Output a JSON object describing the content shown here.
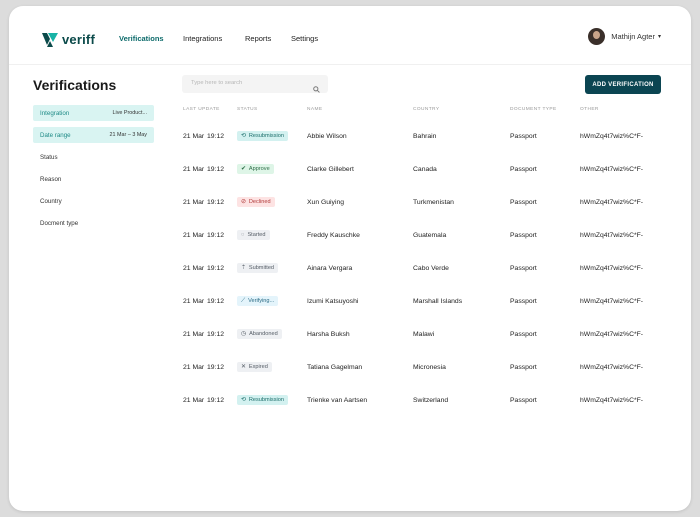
{
  "brand": {
    "name": "veriff"
  },
  "nav": [
    {
      "label": "Verifications",
      "active": true
    },
    {
      "label": "Integrations",
      "active": false
    },
    {
      "label": "Reports",
      "active": false
    },
    {
      "label": "Settings",
      "active": false
    }
  ],
  "user": {
    "name": "Mathijn Agter"
  },
  "page": {
    "title": "Verifications"
  },
  "search": {
    "placeholder": "Type here to search"
  },
  "add_button": {
    "label": "ADD VERIFICATION"
  },
  "filters": [
    {
      "label": "Integration",
      "value": "Live Product...",
      "active": true
    },
    {
      "label": "Date range",
      "value": "21 Mar – 3 May",
      "active": true
    },
    {
      "label": "Status",
      "value": "",
      "active": false
    },
    {
      "label": "Reason",
      "value": "",
      "active": false
    },
    {
      "label": "Country",
      "value": "",
      "active": false
    },
    {
      "label": "Docment type",
      "value": "",
      "active": false
    }
  ],
  "table": {
    "columns": [
      "Last update",
      "Status",
      "Name",
      "Country",
      "Document type",
      "Other"
    ],
    "rows": [
      {
        "date": "21 Mar",
        "time": "19:12",
        "status": "Resubmission",
        "status_kind": "resubmission",
        "name": "Abbie Wilson",
        "country": "Bahrain",
        "doc": "Passport",
        "other": "hWmZq4t7wiz%C*F-"
      },
      {
        "date": "21 Mar",
        "time": "19:12",
        "status": "Approve",
        "status_kind": "approved",
        "name": "Clarke Gillebert",
        "country": "Canada",
        "doc": "Passport",
        "other": "hWmZq4t7wiz%C*F-"
      },
      {
        "date": "21 Mar",
        "time": "19:12",
        "status": "Declined",
        "status_kind": "declined",
        "name": "Xun Guiying",
        "country": "Turkmenistan",
        "doc": "Passport",
        "other": "hWmZq4t7wiz%C*F-"
      },
      {
        "date": "21 Mar",
        "time": "19:12",
        "status": "Started",
        "status_kind": "started",
        "name": "Freddy Kauschke",
        "country": "Guatemala",
        "doc": "Passport",
        "other": "hWmZq4t7wiz%C*F-"
      },
      {
        "date": "21 Mar",
        "time": "19:12",
        "status": "Submitted",
        "status_kind": "submitted",
        "name": "Ainara Vergara",
        "country": "Cabo Verde",
        "doc": "Passport",
        "other": "hWmZq4t7wiz%C*F-"
      },
      {
        "date": "21 Mar",
        "time": "19:12",
        "status": "Verifying...",
        "status_kind": "verifying",
        "name": "Izumi Katsuyoshi",
        "country": "Marshall Islands",
        "doc": "Passport",
        "other": "hWmZq4t7wiz%C*F-"
      },
      {
        "date": "21 Mar",
        "time": "19:12",
        "status": "Abandoned",
        "status_kind": "abandoned",
        "name": "Harsha Buksh",
        "country": "Malawi",
        "doc": "Passport",
        "other": "hWmZq4t7wiz%C*F-"
      },
      {
        "date": "21 Mar",
        "time": "19:12",
        "status": "Expired",
        "status_kind": "expired",
        "name": "Tatiana Gagelman",
        "country": "Micronesia",
        "doc": "Passport",
        "other": "hWmZq4t7wiz%C*F-"
      },
      {
        "date": "21 Mar",
        "time": "19:12",
        "status": "Resubmission",
        "status_kind": "resubmission",
        "name": "Trienke van Aartsen",
        "country": "Switzerland",
        "doc": "Passport",
        "other": "hWmZq4t7wiz%C*F-"
      }
    ]
  },
  "status_styles": {
    "resubmission": {
      "bg": "#d3f1f0",
      "fg": "#1b6d6a",
      "icon": "refresh-icon",
      "glyph": "⟲"
    },
    "approved": {
      "bg": "#def5e7",
      "fg": "#2e6e48",
      "icon": "check-icon",
      "glyph": "✔"
    },
    "declined": {
      "bg": "#fde3e3",
      "fg": "#b23b3b",
      "icon": "declined-icon",
      "glyph": "⊘"
    },
    "started": {
      "bg": "#eef0f3",
      "fg": "#555d66",
      "icon": "spinner-icon",
      "glyph": "◌"
    },
    "submitted": {
      "bg": "#eef0f3",
      "fg": "#555d66",
      "icon": "upload-icon",
      "glyph": "⇡"
    },
    "verifying": {
      "bg": "#e4f4fb",
      "fg": "#2a6b85",
      "icon": "progress-icon",
      "glyph": "⟋"
    },
    "abandoned": {
      "bg": "#eef0f3",
      "fg": "#555d66",
      "icon": "clock-icon",
      "glyph": "◷"
    },
    "expired": {
      "bg": "#eef0f3",
      "fg": "#555d66",
      "icon": "close-icon",
      "glyph": "✕"
    }
  },
  "colors": {
    "accent": "#0d6b6b",
    "button": "#0b4552",
    "filter_active": "#d9f4f2"
  }
}
